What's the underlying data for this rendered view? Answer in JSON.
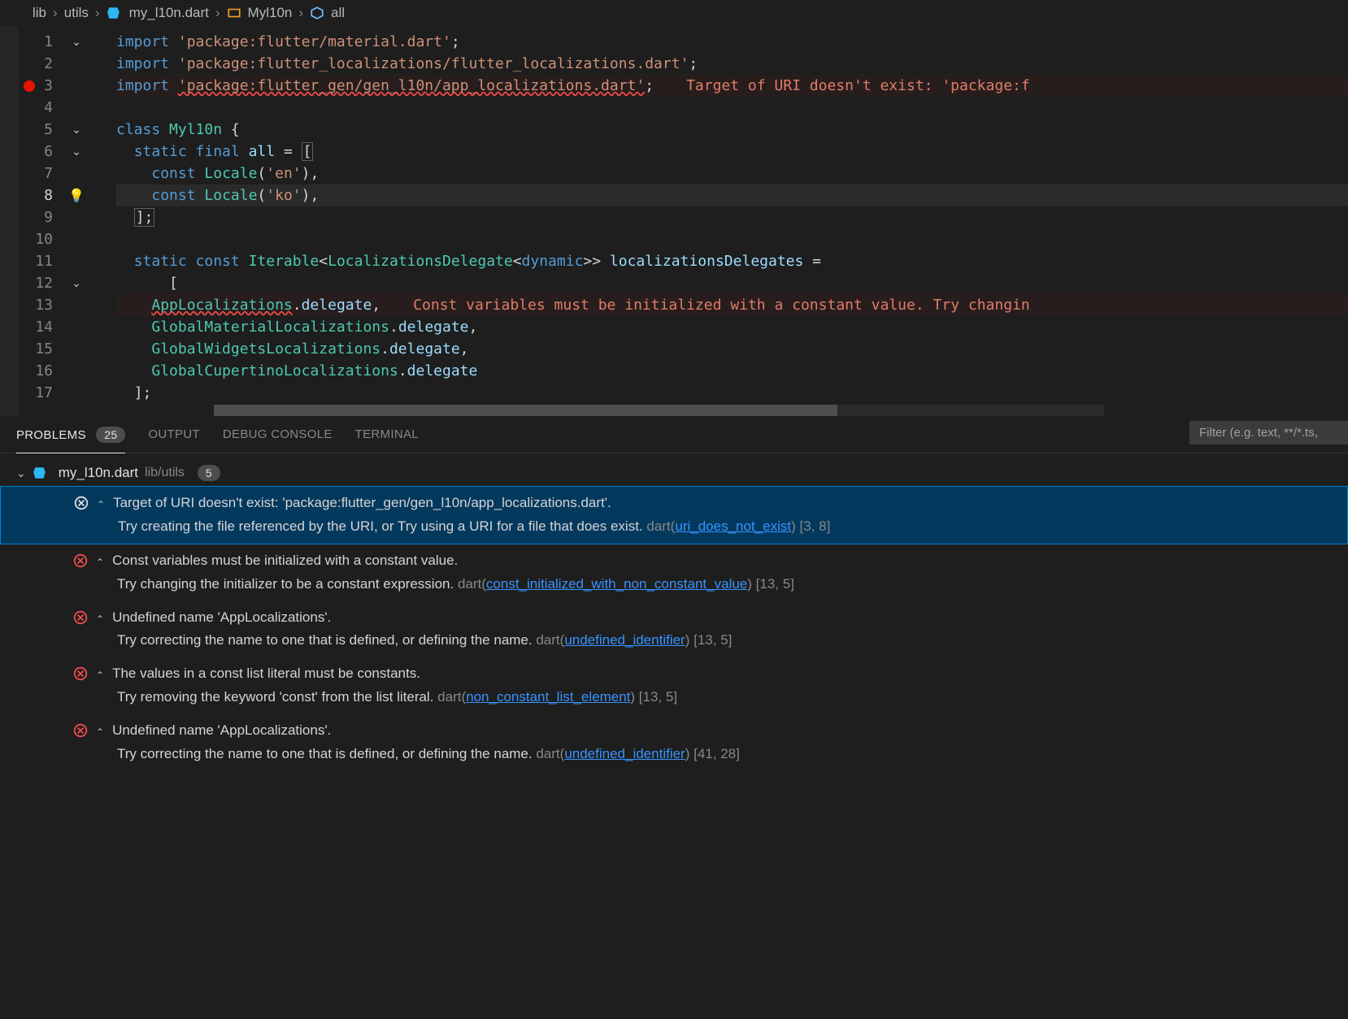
{
  "breadcrumb": {
    "seg1": "lib",
    "seg2": "utils",
    "seg3": "my_l10n.dart",
    "seg4": "Myl10n",
    "seg5": "all"
  },
  "editor": {
    "lines": [
      {
        "n": 1,
        "fold": true
      },
      {
        "n": 2
      },
      {
        "n": 3,
        "bp": true
      },
      {
        "n": 4
      },
      {
        "n": 5,
        "fold": true
      },
      {
        "n": 6,
        "fold": true
      },
      {
        "n": 7
      },
      {
        "n": 8,
        "bulb": true,
        "active": true
      },
      {
        "n": 9
      },
      {
        "n": 10
      },
      {
        "n": 11
      },
      {
        "n": 12,
        "fold": true
      },
      {
        "n": 13
      },
      {
        "n": 14
      },
      {
        "n": 15
      },
      {
        "n": 16
      },
      {
        "n": 17
      }
    ],
    "code": {
      "l1_import": "import ",
      "l1_str": "'package:flutter/material.dart'",
      "l1_semi": ";",
      "l2_import": "import ",
      "l2_str": "'package:flutter_localizations/flutter_localizations.dart'",
      "l2_semi": ";",
      "l3_import": "import ",
      "l3_str": "'package:flutter_gen/gen_l10n/app_localizations.dart'",
      "l3_semi": ";",
      "l3_err": "Target of URI doesn't exist: 'package:f",
      "l5_kw": "class ",
      "l5_cls": "Myl10n ",
      "l5_brace": "{",
      "l6_pad": "  ",
      "l6_kw": "static final ",
      "l6_var": "all ",
      "l6_eq": "= ",
      "l6_brk": "[",
      "l7_pad": "    ",
      "l7_kw": "const ",
      "l7_cls": "Locale",
      "l7_paren": "(",
      "l7_str": "'en'",
      "l7_end": "),",
      "l8_pad": "    ",
      "l8_kw": "const ",
      "l8_cls": "Locale",
      "l8_paren": "(",
      "l8_str": "'ko'",
      "l8_end": "),",
      "l9_pad": "  ",
      "l9_brk": "];",
      "l11_pad": "  ",
      "l11_kw": "static const ",
      "l11_type": "Iterable",
      "l11_lt": "<",
      "l11_type2": "LocalizationsDelegate",
      "l11_lt2": "<",
      "l11_dyn": "dynamic",
      "l11_gt": ">> ",
      "l11_var": "localizationsDelegates ",
      "l11_eq": "=",
      "l12_pad": "      ",
      "l12_brk": "[",
      "l13_pad": "    ",
      "l13_cls": "AppLocalizations",
      "l13_dot": ".",
      "l13_prop": "delegate",
      "l13_comma": ",",
      "l13_err": "Const variables must be initialized with a constant value. Try changin",
      "l14_pad": "    ",
      "l14_cls": "GlobalMaterialLocalizations",
      "l14_dot": ".",
      "l14_prop": "delegate",
      "l14_comma": ",",
      "l15_pad": "    ",
      "l15_cls": "GlobalWidgetsLocalizations",
      "l15_dot": ".",
      "l15_prop": "delegate",
      "l15_comma": ",",
      "l16_pad": "    ",
      "l16_cls": "GlobalCupertinoLocalizations",
      "l16_dot": ".",
      "l16_prop": "delegate",
      "l17_pad": "  ",
      "l17_brk": "];"
    }
  },
  "panel": {
    "tabs": {
      "problems": "PROBLEMS",
      "problems_count": "25",
      "output": "OUTPUT",
      "debug": "DEBUG CONSOLE",
      "terminal": "TERMINAL"
    },
    "filter_placeholder": "Filter (e.g. text, **/*.ts,"
  },
  "problems": {
    "file": {
      "name": "my_l10n.dart",
      "path": "lib/utils",
      "count": "5"
    },
    "items": [
      {
        "msg": "Target of URI doesn't exist: 'package:flutter_gen/gen_l10n/app_localizations.dart'.",
        "hint": "Try creating the file referenced by the URI, or Try using a URI for a file that does exist.",
        "source": "dart",
        "link": "uri_does_not_exist",
        "loc": "[3, 8]",
        "selected": true,
        "white": true
      },
      {
        "msg": "Const variables must be initialized with a constant value.",
        "hint": "Try changing the initializer to be a constant expression.",
        "source": "dart",
        "link": "const_initialized_with_non_constant_value",
        "loc": "[13, 5]"
      },
      {
        "msg": "Undefined name 'AppLocalizations'.",
        "hint": "Try correcting the name to one that is defined, or defining the name.",
        "source": "dart",
        "link": "undefined_identifier",
        "loc": "[13, 5]"
      },
      {
        "msg": "The values in a const list literal must be constants.",
        "hint": "Try removing the keyword 'const' from the list literal.",
        "source": "dart",
        "link": "non_constant_list_element",
        "loc": "[13, 5]"
      },
      {
        "msg": "Undefined name 'AppLocalizations'.",
        "hint": "Try correcting the name to one that is defined, or defining the name.",
        "source": "dart",
        "link": "undefined_identifier",
        "loc": "[41, 28]"
      }
    ]
  }
}
